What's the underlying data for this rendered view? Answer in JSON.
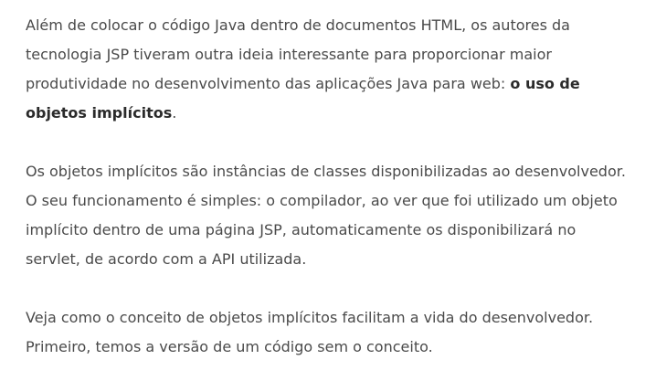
{
  "article": {
    "p1": {
      "text": "Além de colocar o código Java dentro de documentos HTML, os autores da tecnologia JSP tiveram outra ideia interessante para proporcionar maior produtividade no desenvolvimento das aplicações Java para web: ",
      "bold": "o uso de objetos implícitos",
      "end": "."
    },
    "p2": "Os objetos implícitos são instâncias de classes disponibilizadas ao desenvolvedor. O seu funcionamento é simples: o compilador, ao ver que foi utilizado um objeto implícito dentro de uma página JSP, automaticamente os disponibilizará no servlet, de acordo com a API utilizada.",
    "p3": "Veja como o conceito de objetos implícitos facilitam a vida do desenvolvedor. Primeiro, temos a versão de um código sem o conceito."
  }
}
